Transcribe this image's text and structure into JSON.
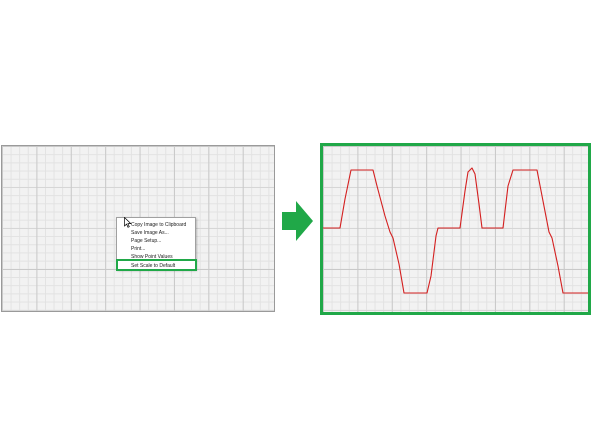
{
  "context_menu": {
    "items": [
      {
        "label": "Copy Image to Clipboard"
      },
      {
        "label": "Save Image As..."
      },
      {
        "label": "Page Setup..."
      },
      {
        "label": "Print..."
      },
      {
        "label": "Show Point Values"
      },
      {
        "label": "Set Scale to Default"
      }
    ]
  },
  "colors": {
    "highlight": "#20a848",
    "trace": "#d42020",
    "arrow": "#20a848"
  },
  "icons": {
    "cursor": "mouse-pointer-icon",
    "arrow": "arrow-right-icon"
  }
}
